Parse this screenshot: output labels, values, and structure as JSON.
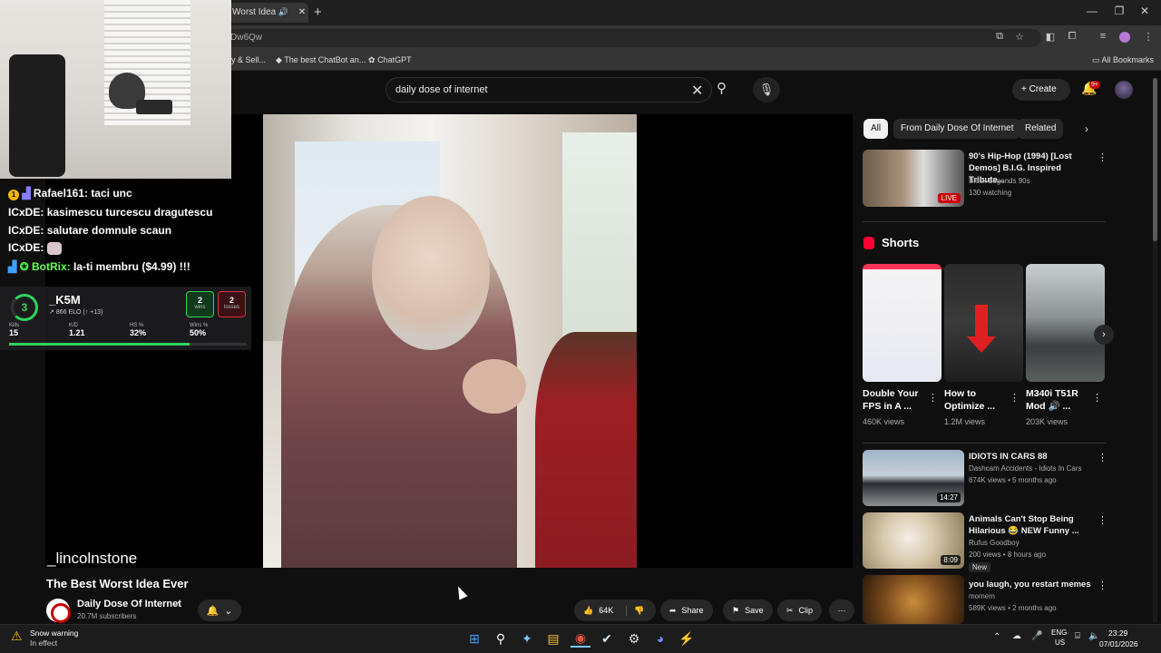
{
  "browser": {
    "tab_title": "Worst Idea E",
    "url_fragment": "Dw6Qw",
    "bookmarks": [
      "y & Sell...",
      "The best ChatBot an...",
      "ChatGPT"
    ],
    "all_bookmarks": "All Bookmarks"
  },
  "header": {
    "search_query": "daily dose of internet",
    "create_label": "Create",
    "notif_count": "9+"
  },
  "overlay": {
    "chat": [
      {
        "user": "Rafael161:",
        "message": "taci unc",
        "user_color": "#8fb4ff"
      },
      {
        "user": "ICxDE:",
        "message": "kasimescu turcescu dragutescu",
        "user_color": "#ffffff"
      },
      {
        "user": "ICxDE:",
        "message": "salutare domnule scaun",
        "user_color": "#ffffff"
      },
      {
        "user": "ICxDE:",
        "message": "",
        "user_color": "#ffffff"
      },
      {
        "user": "BotRix:",
        "message": "Ia-ti membru ($4.99) !!!",
        "user_color": "#6bff5a"
      }
    ],
    "stats": {
      "level": "3",
      "name": "_K5M",
      "elo": "866 ELO",
      "elo_change": "(↑ +13)",
      "wins": "2",
      "wins_label": "wins",
      "losses": "2",
      "losses_label": "losses",
      "cols": [
        {
          "label": "Kills",
          "value": "15"
        },
        {
          "label": "K/D",
          "value": "1.21"
        },
        {
          "label": "HS %",
          "value": "32%"
        },
        {
          "label": "Wins %",
          "value": "50%"
        }
      ]
    },
    "watermark": "_lincolnstone"
  },
  "video": {
    "title": "The Best Worst Idea Ever",
    "channel": "Daily Dose Of Internet",
    "subscribers": "20.7M subscribers",
    "likes": "64K",
    "share": "Share",
    "save": "Save",
    "clip": "Clip"
  },
  "sidebar": {
    "chips": [
      "All",
      "From Daily Dose Of Internet",
      "Related"
    ],
    "top_item": {
      "title": "90's Hip-Hop (1994) [Lost Demos] B.I.G. Inspired Tribute...",
      "channel": "Block Legends 90s",
      "meta": "130 watching",
      "badge": "LIVE"
    },
    "shorts_heading": "Shorts",
    "shorts": [
      {
        "title": "Double Your FPS in A ...",
        "views": "460K views"
      },
      {
        "title": "How to Optimize ...",
        "views": "1.2M views"
      },
      {
        "title": "M340i T51R Mod 🔊 ...",
        "views": "203K views"
      }
    ],
    "items": [
      {
        "title": "IDIOTS IN CARS 88",
        "channel": "Dashcam Accidents - Idiots In Cars",
        "meta": "674K views • 5 months ago",
        "duration": "14:27"
      },
      {
        "title": "Animals Can't Stop Being Hilarious 😂 NEW Funny ...",
        "channel": "Rufus Goodboy",
        "meta": "200 views • 8 hours ago",
        "badge": "New",
        "duration": "8:09"
      },
      {
        "title": "you laugh, you restart memes",
        "channel": "momem",
        "meta": "589K views • 2 months ago",
        "duration": ""
      }
    ]
  },
  "taskbar": {
    "weather_title": "Snow warning",
    "weather_sub": "In effect",
    "lang": "ENG",
    "region": "US",
    "time": "23:29",
    "date": "07/01/2026"
  }
}
